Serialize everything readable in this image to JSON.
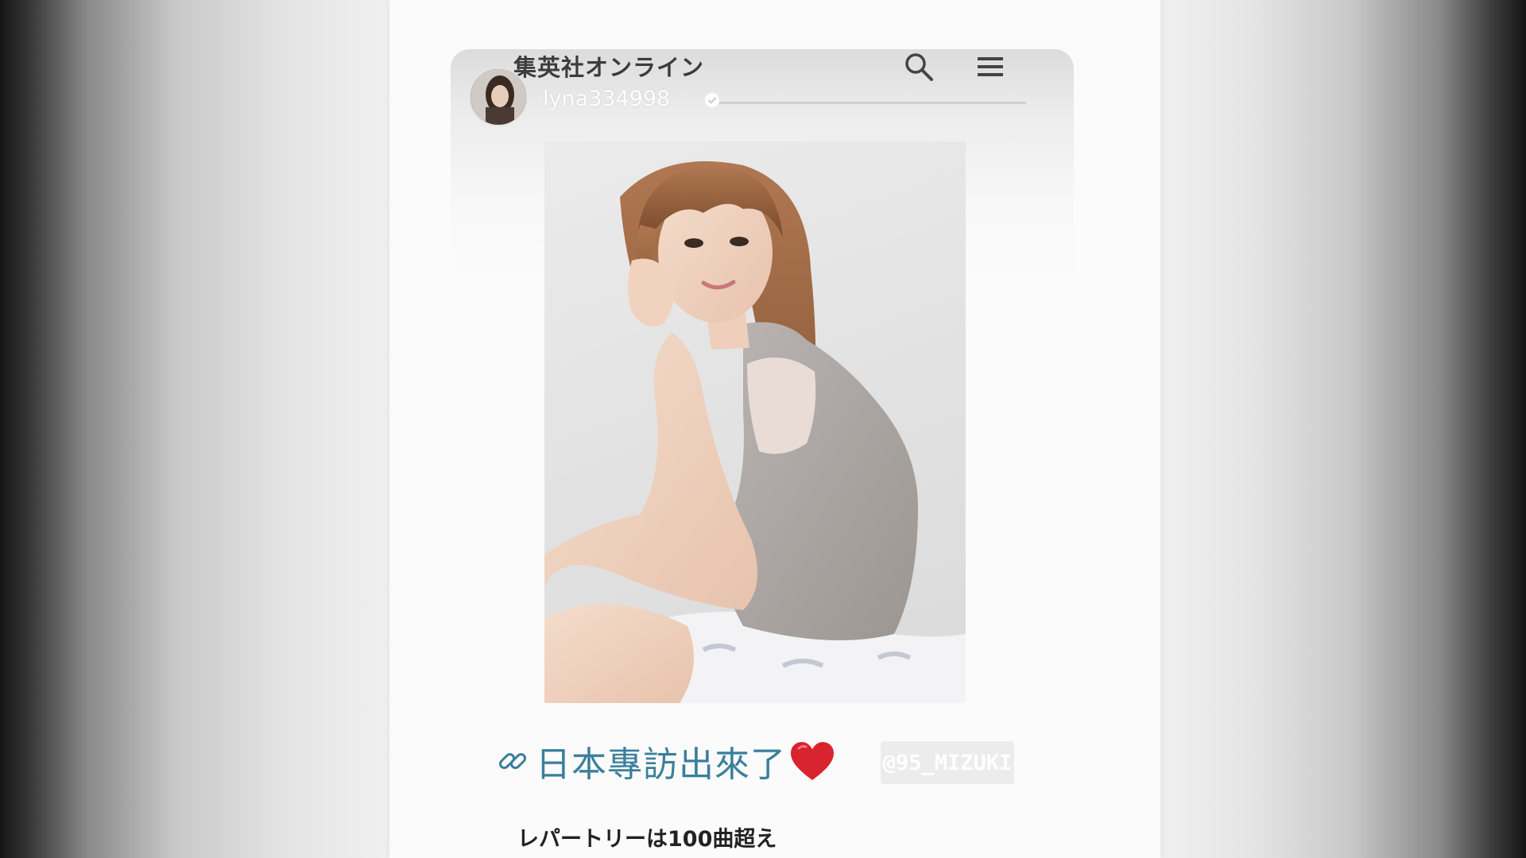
{
  "header": {
    "site_title": "集英社オンライン",
    "username": "lyna334998"
  },
  "icons": {
    "search": "search-icon",
    "menu": "menu-icon",
    "verified": "verified-check-icon",
    "link": "link-icon",
    "heart": "heart-icon"
  },
  "post": {
    "caption": "日本專訪出來了",
    "watermark": "@95_MIZUKI",
    "subtitle": "レパートリーは100曲超え"
  },
  "colors": {
    "caption": "#3a7f9c",
    "heart": "#d9232e",
    "title": "#3c3c3c"
  }
}
